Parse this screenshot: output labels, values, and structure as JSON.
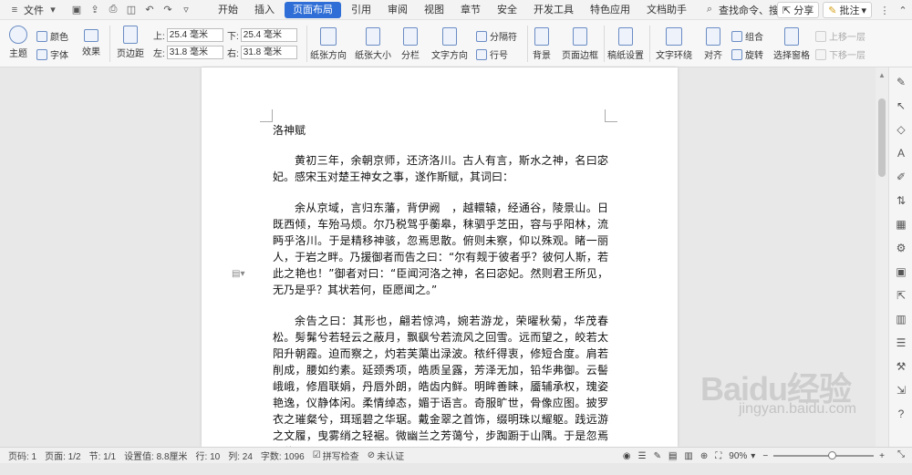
{
  "menubar": {
    "file_label": "文件",
    "tabs": [
      "开始",
      "插入",
      "页面布局",
      "引用",
      "审阅",
      "视图",
      "章节",
      "安全",
      "开发工具",
      "特色应用",
      "文档助手"
    ],
    "active_tab": "页面布局",
    "search_label": "查找命令、搜索模板",
    "share_label": "分享",
    "comment_label": "批注"
  },
  "toolbar": {
    "theme": "主题",
    "colors": "颜色",
    "fonts": "字体",
    "effects": "效果",
    "margins": "页边距",
    "top_label": "上:",
    "top_value": "25.4 毫米",
    "bottom_label": "下:",
    "bottom_value": "25.4 毫米",
    "left_label": "左:",
    "left_value": "31.8 毫米",
    "right_label": "右:",
    "right_value": "31.8 毫米",
    "orientation": "纸张方向",
    "size": "纸张大小",
    "columns": "分栏",
    "text_direction": "文字方向",
    "breaks": "分隔符",
    "line_numbers": "行号",
    "background": "背景",
    "page_border": "页面边框",
    "draft_settings": "稿纸设置",
    "wrap_text": "文字环绕",
    "align": "对齐",
    "group": "组合",
    "rotate": "旋转",
    "selection_pane": "选择窗格",
    "bring_forward": "上移一层",
    "send_backward": "下移一层"
  },
  "document": {
    "title": "洛神赋",
    "paragraphs": [
      "黄初三年，余朝京师，还济洛川。古人有言，斯水之神，名曰宓妃。感宋玉对楚王神女之事，遂作斯赋，其词曰：",
      "余从京域，言归东藩，背伊阙　，越轘辕，经通谷，陵景山。日既西倾，车殆马烦。尔乃税驾乎蘅皋，秣驷乎芝田，容与乎阳林，流眄乎洛川。于是精移神骇，忽焉思散。俯则未察，仰以殊观。睹一丽人，于岩之畔。乃援御者而告之曰：“尔有觌于彼者乎？彼何人斯，若此之艳也！”御者对曰：“臣闻河洛之神，名曰宓妃。然则君王所见，无乃是乎？其状若何，臣愿闻之。”",
      "余告之曰：其形也，翩若惊鸿，婉若游龙，荣曜秋菊，华茂春松。髣髴兮若轻云之蔽月，飘飖兮若流风之回雪。远而望之，皎若太阳升朝霞。迫而察之，灼若芙蕖出渌波。秾纤得衷，修短合度。肩若削成，腰如约素。延颈秀项，皓质呈露，芳泽无加，铅华弗御。云髻峨峨，修眉联娟，丹唇外朗，皓齿内鲜。明眸善睐，靥辅承权，瑰姿艳逸，仪静体闲。柔情绰态，媚于语言。奇服旷世，骨像应图。披罗衣之璀粲兮，珥瑶碧之华琚。戴金翠之首饰，缀明珠以耀躯。践远游之文履，曳雾绡之轻裾。微幽兰之芳蔼兮，步踟蹰于山隅。于是忽焉纵体，以"
    ]
  },
  "statusbar": {
    "page_code": "页码: 1",
    "pages": "页面: 1/2",
    "section": "节: 1/1",
    "setting": "设置值: 8.8厘米",
    "row": "行: 10",
    "col": "列: 24",
    "word_count": "字数: 1096",
    "spell_check": "拼写检查",
    "auth": "未认证",
    "zoom": "90%"
  },
  "watermark": {
    "logo_text": "Baidu经验",
    "url": "jingyan.baidu.com"
  }
}
